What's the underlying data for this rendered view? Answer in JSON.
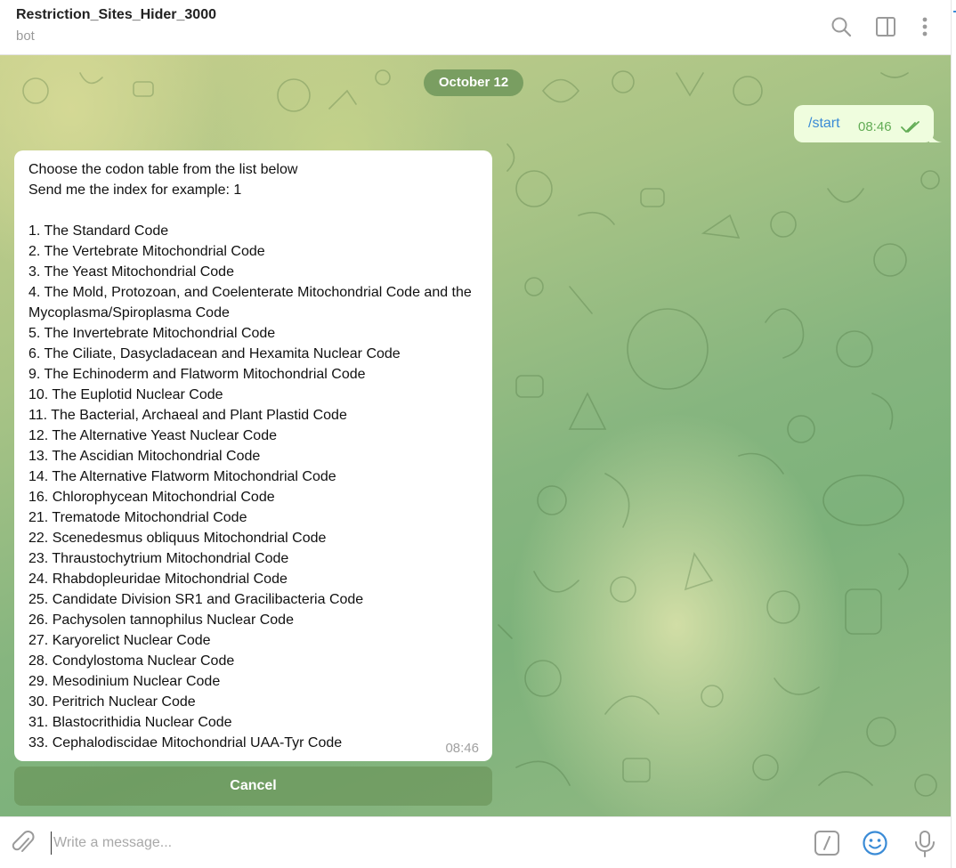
{
  "header": {
    "title": "Restriction_Sites_Hider_3000",
    "subtitle": "bot",
    "icons": [
      "search-icon",
      "sidebar-icon",
      "more-vertical-icon"
    ]
  },
  "chat": {
    "date_label": "October 12",
    "outgoing": {
      "text": "/start",
      "time": "08:46",
      "status": "read"
    },
    "incoming": {
      "lines": [
        "Choose the codon table from the list below",
        "Send me the index for example: 1",
        "",
        "1. The Standard Code",
        "2. The Vertebrate Mitochondrial Code",
        "3. The Yeast Mitochondrial Code",
        "4. The Mold, Protozoan, and Coelenterate Mitochondrial Code and the Mycoplasma/Spiroplasma Code",
        "5. The Invertebrate Mitochondrial Code",
        "6. The Ciliate, Dasycladacean and Hexamita Nuclear Code",
        "9. The Echinoderm and Flatworm Mitochondrial Code",
        "10. The Euplotid Nuclear Code",
        "11. The Bacterial, Archaeal and Plant Plastid Code",
        "12. The Alternative Yeast Nuclear Code",
        "13. The Ascidian Mitochondrial Code",
        "14. The Alternative Flatworm Mitochondrial Code",
        "16. Chlorophycean Mitochondrial Code",
        "21. Trematode Mitochondrial Code",
        "22. Scenedesmus obliquus Mitochondrial Code",
        "23. Thraustochytrium Mitochondrial Code",
        "24. Rhabdopleuridae Mitochondrial Code",
        "25. Candidate Division SR1 and Gracilibacteria Code",
        "26. Pachysolen tannophilus Nuclear Code",
        "27. Karyorelict Nuclear Code",
        "28. Condylostoma Nuclear Code",
        "29. Mesodinium Nuclear Code",
        "30. Peritrich Nuclear Code",
        "31. Blastocrithidia Nuclear Code",
        "33. Cephalodiscidae Mitochondrial UAA-Tyr Code"
      ],
      "time": "08:46"
    },
    "keyboard_button": "Cancel"
  },
  "composer": {
    "placeholder": "Write a message...",
    "icons": [
      "attach-icon",
      "bot-commands-icon",
      "emoji-icon",
      "microphone-icon"
    ]
  },
  "colors": {
    "accent": "#3a8bd6",
    "outgoing_bubble": "#effdde",
    "read_check": "#62ac55",
    "icon_gray": "#9a9a9a"
  }
}
